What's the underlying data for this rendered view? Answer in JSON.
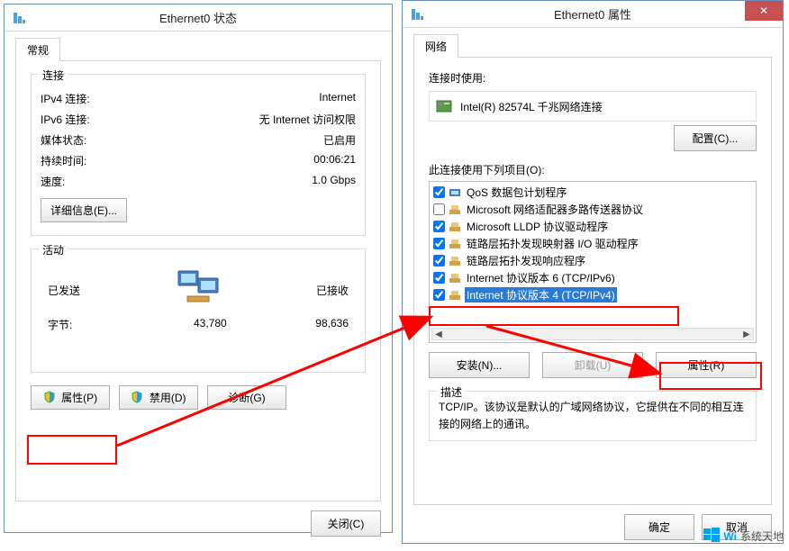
{
  "status_window": {
    "title": "Ethernet0 状态",
    "tab": "常规",
    "group_conn": {
      "legend": "连接",
      "ipv4_label": "IPv4 连接:",
      "ipv4_value": "Internet",
      "ipv6_label": "IPv6 连接:",
      "ipv6_value": "无 Internet 访问权限",
      "media_label": "媒体状态:",
      "media_value": "已启用",
      "duration_label": "持续时间:",
      "duration_value": "00:06:21",
      "speed_label": "速度:",
      "speed_value": "1.0 Gbps",
      "details_btn": "详细信息(E)..."
    },
    "group_activity": {
      "legend": "活动",
      "sent_label": "已发送",
      "recv_label": "已接收",
      "bytes_label": "字节:",
      "sent_value": "43,780",
      "recv_value": "98,636"
    },
    "buttons": {
      "properties": "属性(P)",
      "disable": "禁用(D)",
      "diagnose": "诊断(G)"
    },
    "close_btn": "关闭(C)"
  },
  "props_window": {
    "title": "Ethernet0 属性",
    "tab": "网络",
    "connect_using_label": "连接时使用:",
    "adapter": "Intel(R) 82574L 千兆网络连接",
    "configure_btn": "配置(C)...",
    "items_label": "此连接使用下列项目(O):",
    "items": [
      {
        "checked": true,
        "icon": "b",
        "label": "QoS 数据包计划程序"
      },
      {
        "checked": false,
        "icon": "y",
        "label": "Microsoft 网络适配器多路传送器协议"
      },
      {
        "checked": true,
        "icon": "y",
        "label": "Microsoft LLDP 协议驱动程序"
      },
      {
        "checked": true,
        "icon": "y",
        "label": "链路层拓扑发现映射器 I/O 驱动程序"
      },
      {
        "checked": true,
        "icon": "y",
        "label": "链路层拓扑发现响应程序"
      },
      {
        "checked": true,
        "icon": "y",
        "label": "Internet 协议版本 6 (TCP/IPv6)"
      },
      {
        "checked": true,
        "icon": "y",
        "label": "Internet 协议版本 4 (TCP/IPv4)",
        "selected": true
      }
    ],
    "install_btn": "安装(N)...",
    "uninstall_btn": "卸载(U)",
    "properties_btn": "属性(R)",
    "desc_legend": "描述",
    "desc_text": "TCP/IP。该协议是默认的广域网络协议，它提供在不同的相互连接的网络上的通讯。",
    "ok_btn": "确定",
    "cancel_btn": "取消"
  },
  "watermark": {
    "brand": "Wi",
    "site": "系统天地"
  }
}
